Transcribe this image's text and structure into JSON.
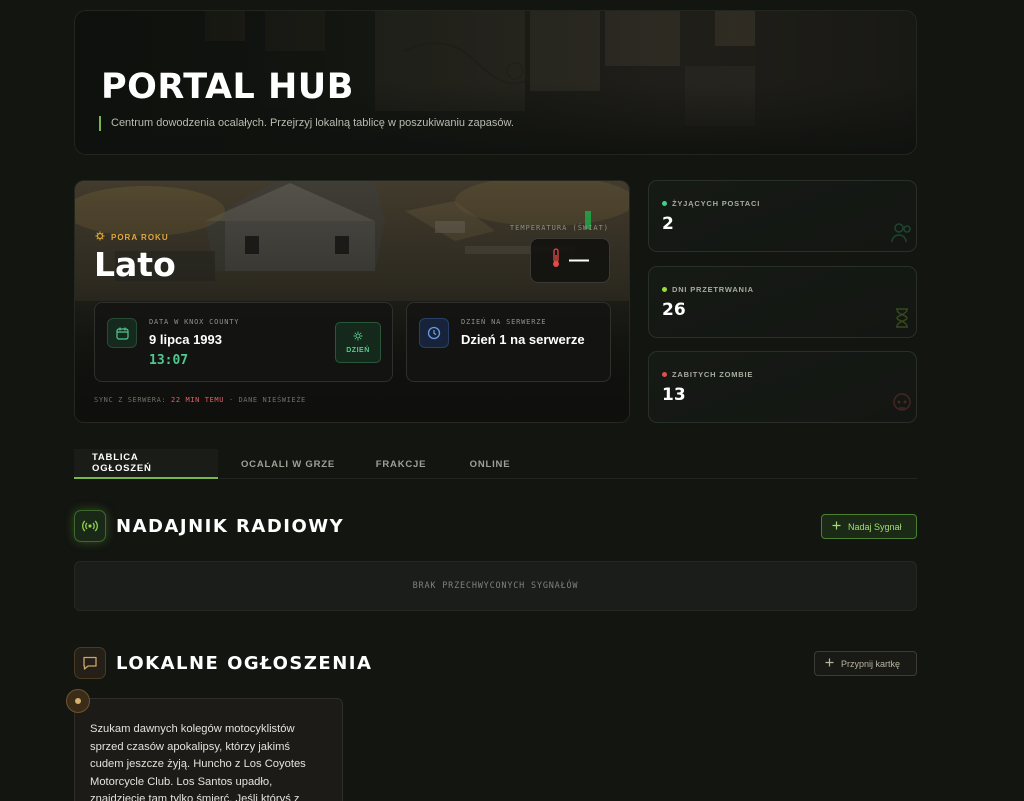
{
  "hero": {
    "title": "PORTAL HUB",
    "subtitle": "Centrum dowodzenia ocalałych. Przejrzyj lokalną tablicę w poszukiwaniu zapasów."
  },
  "season": {
    "label": "PORA ROKU",
    "name": "Lato",
    "temperature_label": "TEMPERATURA (ŚWIAT)",
    "temperature_value": "—",
    "date_card": {
      "label": "DATA W KNOX COUNTY",
      "date": "9 lipca 1993",
      "time": "13:07",
      "day_badge": "DZIEŃ"
    },
    "server_card": {
      "label": "DZIEŃ NA SERWERZE",
      "value": "Dzień 1 na serwerze"
    },
    "sync": {
      "prefix": "SYNC Z SERWERA:",
      "ago": "22 MIN TEMU",
      "suffix": "· DANE NIEŚWIEŻE"
    }
  },
  "stats": [
    {
      "label": "ŻYJĄCYCH POSTACI",
      "value": "2",
      "dot_color": "#3ecf8e",
      "icon": "users-icon"
    },
    {
      "label": "DNI PRZETRWANIA",
      "value": "26",
      "dot_color": "#9bdc3c",
      "icon": "hourglass-icon"
    },
    {
      "label": "ZABITYCH ZOMBIE",
      "value": "13",
      "dot_color": "#e05050",
      "icon": "skull-icon"
    }
  ],
  "tabs": [
    {
      "label": "TABLICA OGŁOSZEŃ",
      "active": true
    },
    {
      "label": "OCALALI W GRZE",
      "active": false
    },
    {
      "label": "FRAKCJE",
      "active": false
    },
    {
      "label": "ONLINE",
      "active": false
    }
  ],
  "radio": {
    "title": "NADAJNIK RADIOWY",
    "button": "Nadaj Sygnał",
    "empty": "BRAK PRZECHWYCONYCH SYGNAŁÓW"
  },
  "board": {
    "title": "LOKALNE OGŁOSZENIA",
    "button": "Przypnij kartkę",
    "notes": [
      {
        "text": "Szukam dawnych kolegów motocyklistów sprzed czasów apokalipsy, którzy jakimś cudem jeszcze żyją. Huncho z Los Coyotes Motorcycle Club. Los Santos upadło, znajdziecie tam tylko śmierć. Jeśli któryś z"
      }
    ]
  },
  "colors": {
    "accent": "#7ab648",
    "background": "#121510",
    "season_label": "#e0a93a",
    "time": "#4fc98d"
  }
}
